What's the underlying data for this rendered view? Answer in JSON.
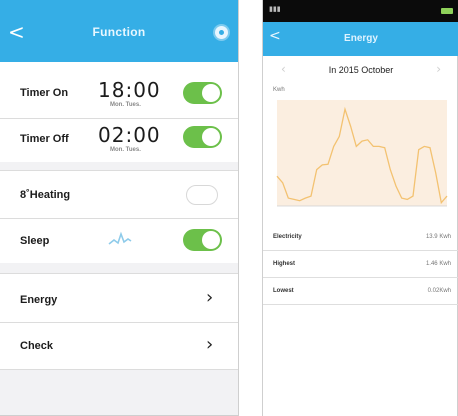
{
  "left": {
    "header": {
      "title": "Function"
    },
    "timer_on": {
      "label": "Timer On",
      "time": "18:00",
      "days": "Mon. Tues.",
      "enabled": true
    },
    "timer_off": {
      "label": "Timer Off",
      "time": "02:00",
      "days": "Mon. Tues.",
      "enabled": true
    },
    "heating": {
      "label": "8˚Heating",
      "enabled": false
    },
    "sleep": {
      "label": "Sleep",
      "enabled": true
    },
    "energy": {
      "label": "Energy"
    },
    "check": {
      "label": "Check"
    }
  },
  "right": {
    "header": {
      "title": "Energy"
    },
    "month": "In 2015 October",
    "unit": "Kwh",
    "stats": [
      {
        "label": "Electricity",
        "value": "13.9 Kwh"
      },
      {
        "label": "Highest",
        "value": "1.46 Kwh"
      },
      {
        "label": "Lowest",
        "value": "0.02Kwh"
      }
    ]
  },
  "chart_data": {
    "type": "line",
    "x": [
      1,
      2,
      3,
      4,
      5,
      6,
      7,
      8,
      9,
      10,
      11,
      12,
      13,
      14,
      15,
      16,
      17,
      18,
      19,
      20,
      21,
      22,
      23,
      24,
      25,
      26,
      27,
      28,
      29,
      30,
      31
    ],
    "values": [
      0.45,
      0.35,
      0.12,
      0.1,
      0.08,
      0.12,
      0.15,
      0.55,
      0.62,
      0.63,
      0.9,
      1.05,
      1.46,
      1.2,
      0.9,
      0.98,
      1.0,
      0.9,
      0.9,
      0.88,
      0.55,
      0.3,
      0.12,
      0.1,
      0.15,
      0.85,
      0.9,
      0.88,
      0.5,
      0.05,
      0.15
    ],
    "ylim": [
      0,
      1.6
    ],
    "line_color": "#f3c271",
    "fill_color": "#fbeee0"
  },
  "colors": {
    "accent": "#35aee6",
    "toggle_on": "#6cc04a"
  }
}
